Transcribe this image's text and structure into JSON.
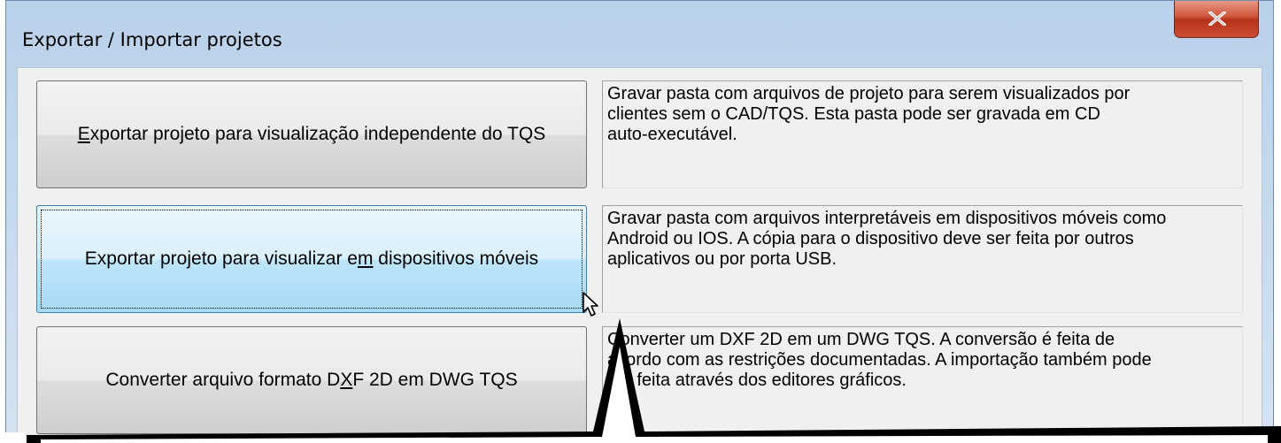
{
  "window": {
    "title": "Exportar / Importar projetos",
    "close_symbol": "X"
  },
  "options": [
    {
      "button_label": "Exportar projeto para visualização independente do TQS",
      "accelerator": "E",
      "description": "Gravar pasta com arquivos de projeto para serem visualizados por\nclientes sem o CAD/TQS. Esta pasta pode ser gravada em CD\nauto-executável.",
      "focused": false
    },
    {
      "button_label": "Exportar projeto para visualizar em dispositivos móveis",
      "accelerator": "m",
      "description": "Gravar pasta com arquivos interpretáveis em dispositivos móveis como\nAndroid ou IOS. A cópia para o dispositivo deve ser feita por outros\naplicativos ou por porta USB.",
      "focused": true
    },
    {
      "button_label": "Converter arquivo formato DXF 2D em DWG TQS",
      "accelerator": "X",
      "description": "Converter um DXF 2D em um DWG TQS. A conversão é feita de\nacordo com as restrições documentadas. A importação também pode\nser feita através dos editores gráficos.",
      "focused": false
    }
  ],
  "icons": {
    "close": "close-icon",
    "cursor": "mouse-pointer-icon"
  },
  "colors": {
    "titlebar": "#c8dbee",
    "close_button": "#c7452b",
    "focused_button": "#bee6fd",
    "annotation": "#000000"
  }
}
